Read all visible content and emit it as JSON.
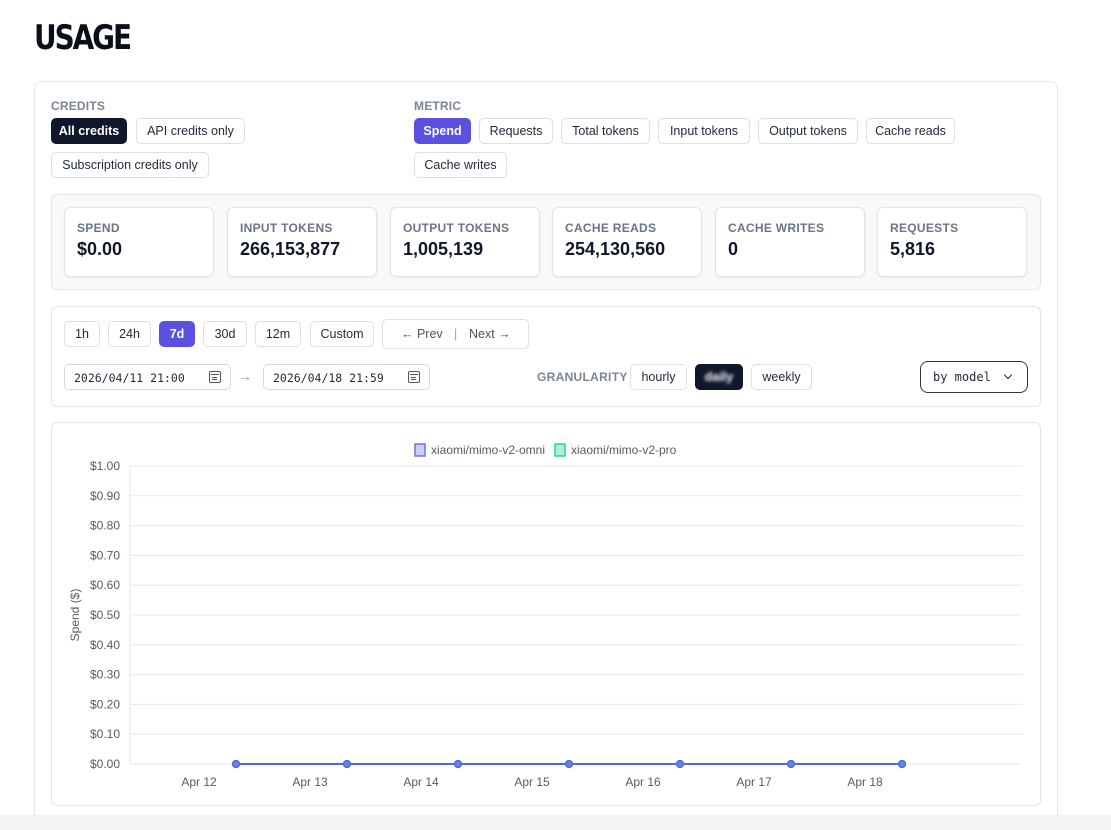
{
  "page": {
    "title": "USAGE"
  },
  "credits": {
    "label": "CREDITS",
    "options": [
      {
        "label": "All credits",
        "selected": true
      },
      {
        "label": "API credits only",
        "selected": false
      },
      {
        "label": "Subscription credits only",
        "selected": false
      }
    ]
  },
  "metric": {
    "label": "METRIC",
    "options": [
      {
        "label": "Spend",
        "selected": true
      },
      {
        "label": "Requests",
        "selected": false
      },
      {
        "label": "Total tokens",
        "selected": false
      },
      {
        "label": "Input tokens",
        "selected": false
      },
      {
        "label": "Output tokens",
        "selected": false
      },
      {
        "label": "Cache reads",
        "selected": false
      },
      {
        "label": "Cache writes",
        "selected": false
      }
    ]
  },
  "stats": [
    {
      "label": "SPEND",
      "value": "$0.00"
    },
    {
      "label": "INPUT TOKENS",
      "value": "266,153,877"
    },
    {
      "label": "OUTPUT TOKENS",
      "value": "1,005,139"
    },
    {
      "label": "CACHE READS",
      "value": "254,130,560"
    },
    {
      "label": "CACHE WRITES",
      "value": "0"
    },
    {
      "label": "REQUESTS",
      "value": "5,816"
    }
  ],
  "range": {
    "options": [
      {
        "label": "1h",
        "selected": false
      },
      {
        "label": "24h",
        "selected": false
      },
      {
        "label": "7d",
        "selected": true
      },
      {
        "label": "30d",
        "selected": false
      },
      {
        "label": "12m",
        "selected": false
      },
      {
        "label": "Custom",
        "selected": false
      }
    ],
    "prev_label": "← Prev",
    "separator": "|",
    "next_label": "Next →",
    "start": "2026/04/11 21:00",
    "end": "2026/04/18 21:59",
    "arrow": "→"
  },
  "granularity": {
    "label": "GRANULARITY",
    "options": [
      {
        "label": "hourly",
        "selected": false
      },
      {
        "label": "daily",
        "selected": true
      },
      {
        "label": "weekly",
        "selected": false
      }
    ]
  },
  "group_by": {
    "value": "by model"
  },
  "colors": {
    "accent": "#5b51e0",
    "dark": "#0f172a",
    "series1": "#6b73e6",
    "series2": "#2ccf9b"
  },
  "chart_data": {
    "type": "line",
    "ylabel": "Spend ($)",
    "xlabel": "",
    "ylim": [
      0,
      1
    ],
    "yticks": [
      "$1.00",
      "$0.90",
      "$0.80",
      "$0.70",
      "$0.60",
      "$0.50",
      "$0.40",
      "$0.30",
      "$0.20",
      "$0.10",
      "$0.00"
    ],
    "xticks": [
      "Apr 12",
      "Apr 13",
      "Apr 14",
      "Apr 15",
      "Apr 16",
      "Apr 17",
      "Apr 18"
    ],
    "grid": true,
    "legend_position": "top",
    "series": [
      {
        "name": "xiaomi/mimo-v2-omni",
        "values": [
          0,
          0,
          0,
          0,
          0,
          0,
          0
        ]
      },
      {
        "name": "xiaomi/mimo-v2-pro",
        "values": [
          0,
          0,
          0,
          0,
          0,
          0,
          0
        ]
      }
    ]
  }
}
